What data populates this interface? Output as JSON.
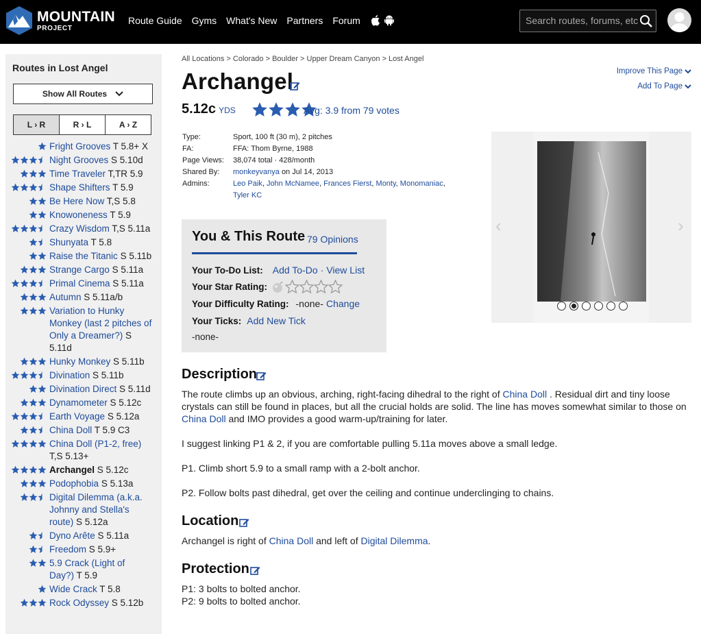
{
  "header": {
    "logo_line1": "MOUNTAIN",
    "logo_line2": "PROJECT",
    "nav": [
      "Route Guide",
      "Gyms",
      "What's New",
      "Partners",
      "Forum"
    ],
    "search_placeholder": "Search routes, forums, etc",
    "colors": {
      "bar": "#000000",
      "link": "#1e4b9a",
      "star": "#2a5db0"
    }
  },
  "sidebar": {
    "title": "Routes in Lost Angel",
    "show_all": "Show All Routes",
    "sort": [
      "L › R",
      "R › L",
      "A › Z"
    ],
    "routes": [
      {
        "stars": 1,
        "name": "Fright Grooves",
        "grade": "T 5.8+ X"
      },
      {
        "stars": 3.5,
        "name": "Night Grooves",
        "grade": "S 5.10d"
      },
      {
        "stars": 3,
        "name": "Time Traveler",
        "grade": "T,TR 5.9"
      },
      {
        "stars": 3.5,
        "name": "Shape Shifters",
        "grade": "T 5.9"
      },
      {
        "stars": 2,
        "name": "Be Here Now",
        "grade": "T,S 5.8"
      },
      {
        "stars": 2,
        "name": "Knowoneness",
        "grade": "T 5.9"
      },
      {
        "stars": 3.5,
        "name": "Crazy Wisdom",
        "grade": "T,S 5.11a"
      },
      {
        "stars": 1.5,
        "name": "Shunyata",
        "grade": "T 5.8"
      },
      {
        "stars": 2,
        "name": "Raise the Titanic",
        "grade": "S 5.11b"
      },
      {
        "stars": 3,
        "name": "Strange Cargo",
        "grade": "S 5.11a"
      },
      {
        "stars": 3.5,
        "name": "Primal Cinema",
        "grade": "S 5.11a"
      },
      {
        "stars": 3,
        "name": "Autumn",
        "grade": "S 5.11a/b"
      },
      {
        "stars": 3,
        "name": "Variation to Hunky Monkey (last 2 pitches of Only a Dreamer?)",
        "grade": "S 5.11d"
      },
      {
        "stars": 3,
        "name": "Hunky Monkey",
        "grade": "S 5.11b"
      },
      {
        "stars": 3.5,
        "name": "Divination",
        "grade": "S 5.11b"
      },
      {
        "stars": 2,
        "name": "Divination Direct",
        "grade": "S 5.11d"
      },
      {
        "stars": 3,
        "name": "Dynamometer",
        "grade": "S 5.12c"
      },
      {
        "stars": 3.5,
        "name": "Earth Voyage",
        "grade": "S 5.12a"
      },
      {
        "stars": 2.5,
        "name": "China Doll",
        "grade": "T 5.9 C3"
      },
      {
        "stars": 4,
        "name": "China Doll (P1-2, free)",
        "grade": "T,S 5.13+"
      },
      {
        "stars": 4,
        "name": "Archangel",
        "grade": "S 5.12c",
        "current": true
      },
      {
        "stars": 3,
        "name": "Podophobia",
        "grade": "S 5.13a"
      },
      {
        "stars": 2.5,
        "name": "Digital Dilemma (a.k.a. Johnny and Stella's route)",
        "grade": "S 5.12a"
      },
      {
        "stars": 1.5,
        "name": "Dyno Arête",
        "grade": "S 5.11a"
      },
      {
        "stars": 1.5,
        "name": "Freedom",
        "grade": "S 5.9+"
      },
      {
        "stars": 2,
        "name": "5.9 Crack (Light of Day?)",
        "grade": "T 5.9"
      },
      {
        "stars": 1,
        "name": "Wide Crack",
        "grade": "T 5.8"
      },
      {
        "stars": 3,
        "name": "Rock Odyssey",
        "grade": "S 5.12b"
      }
    ]
  },
  "page": {
    "breadcrumb": "All Locations > Colorado > Boulder > Upper Dream Canyon > Lost Angel",
    "improve": "Improve This Page",
    "add_to": "Add To Page",
    "title": "Archangel",
    "grade": "5.12c",
    "grade_system": "YDS",
    "avg_rating": "Avg: 3.9 from 79 votes",
    "avg_stars": 3.9
  },
  "details": {
    "type_k": "Type:",
    "type_v": "Sport, 100 ft (30 m), 2 pitches",
    "fa_k": "FA:",
    "fa_v": "FFA: Thom Byrne, 1988",
    "views_k": "Page Views:",
    "views_v": "38,074 total · 428/month",
    "shared_k": "Shared By:",
    "shared_user": "monkeyvanya",
    "shared_date": "on Jul 14, 2013",
    "admins_k": "Admins:",
    "admins": [
      "Leo Paik",
      "John McNamee",
      "Frances Fierst",
      "Monty",
      "Monomaniac",
      "Tyler KC"
    ]
  },
  "photos": {
    "count": 6,
    "active": 2
  },
  "you": {
    "title": "You & This Route",
    "opinions": "79 Opinions",
    "todo_k": "Your To-Do List:",
    "todo_add": "Add To-Do",
    "todo_sep": "·",
    "todo_view": "View List",
    "star_k": "Your Star Rating:",
    "diff_k": "Your Difficulty Rating:",
    "diff_v": "-none-",
    "diff_change": "Change",
    "ticks_k": "Your Ticks:",
    "ticks_add": "Add New Tick",
    "ticks_none": "-none-"
  },
  "description": {
    "heading": "Description",
    "p1_a": "The route climbs up an obvious, arching, right-facing dihedral to the right of ",
    "p1_link1": "China Doll",
    "p1_b": " . Residual dirt and tiny loose crystals can still be found in places, but all the crucial holds are solid. The line has moves somewhat similar to those on ",
    "p1_link2": "China Doll",
    "p1_c": " and IMO provides a good warm-up/training for later.",
    "p2": "I suggest linking P1 & 2, if you are comfortable pulling 5.11a moves above a small ledge.",
    "p3": "P1. Climb short 5.9 to a small ramp with a 2-bolt anchor.",
    "p4": "P2. Follow bolts past dihedral, get over the ceiling and continue underclinging to chains."
  },
  "location": {
    "heading": "Location",
    "a": "Archangel is right of ",
    "link1": "China Doll",
    "b": " and left of ",
    "link2": "Digital Dilemma",
    "c": "."
  },
  "protection": {
    "heading": "Protection",
    "p1": "P1: 3 bolts to bolted anchor.",
    "p2": "P2: 9 bolts to bolted anchor."
  }
}
